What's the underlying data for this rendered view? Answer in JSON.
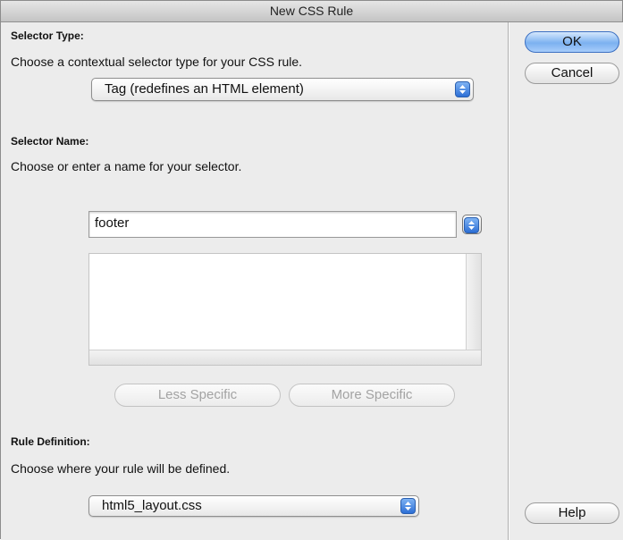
{
  "dialog": {
    "title": "New CSS Rule"
  },
  "selector_type": {
    "heading": "Selector Type:",
    "instruction": "Choose a contextual selector type for your CSS rule.",
    "selected": "Tag (redefines an HTML element)"
  },
  "selector_name": {
    "heading": "Selector Name:",
    "instruction": "Choose or enter a name for your selector.",
    "value": "footer",
    "less_specific": "Less Specific",
    "more_specific": "More Specific"
  },
  "rule_definition": {
    "heading": "Rule Definition:",
    "instruction": "Choose where your rule will be defined.",
    "selected": "html5_layout.css"
  },
  "buttons": {
    "ok": "OK",
    "cancel": "Cancel",
    "help": "Help"
  },
  "colors": {
    "default_button": "#7cb1f0",
    "stepper": "#2d6fd6"
  }
}
